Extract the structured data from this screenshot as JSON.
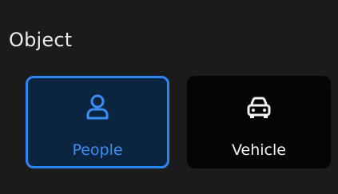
{
  "section": {
    "title": "Object"
  },
  "options": [
    {
      "id": "people",
      "label": "People",
      "icon": "person-icon",
      "selected": true
    },
    {
      "id": "vehicle",
      "label": "Vehicle",
      "icon": "car-icon",
      "selected": false
    }
  ],
  "colors": {
    "background": "#1b1b1b",
    "accent": "#2d85f2",
    "selected_card_bg": "#0b2540",
    "card_bg": "#050505",
    "text": "#ececec"
  }
}
